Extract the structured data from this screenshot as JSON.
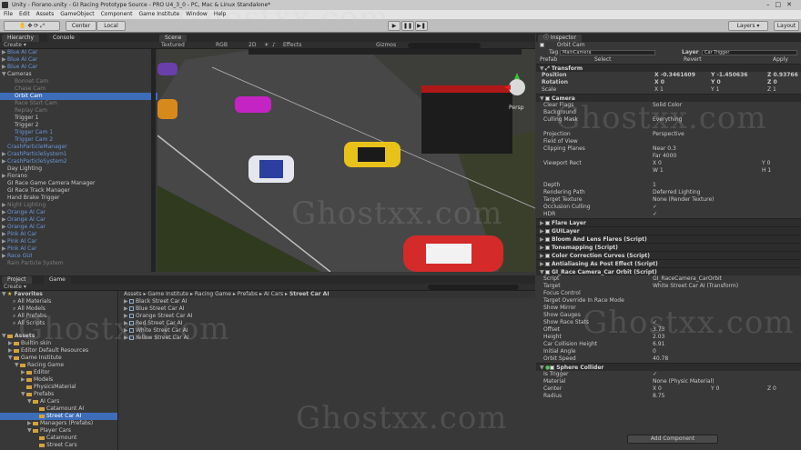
{
  "window": {
    "title": "Unity - Fiorano.unity - GI Racing Prototype Source - PRO U4_3_0 - PC, Mac & Linux Standalone*"
  },
  "menu": [
    "File",
    "Edit",
    "Assets",
    "GameObject",
    "Component",
    "Game Institute",
    "Window",
    "Help"
  ],
  "toolbar": {
    "pivot_label": "Center",
    "space_label": "Local",
    "layers_label": "Layers",
    "layout_label": "Layout"
  },
  "hierarchy": {
    "tab": "Hierarchy",
    "console_tab": "Console",
    "create_label": "Create",
    "items": [
      {
        "label": "Blue AI Car",
        "style": "blue",
        "indent": 0,
        "tri": "▶"
      },
      {
        "label": "Blue AI Car",
        "style": "blue",
        "indent": 0,
        "tri": "▶"
      },
      {
        "label": "Blue AI Car",
        "style": "blue",
        "indent": 0,
        "tri": "▶"
      },
      {
        "label": "Cameras",
        "style": "",
        "indent": 0,
        "tri": "▼"
      },
      {
        "label": "Bonnet Cam",
        "style": "dim",
        "indent": 1,
        "tri": ""
      },
      {
        "label": "Chase Cam",
        "style": "dim",
        "indent": 1,
        "tri": ""
      },
      {
        "label": "Orbit Cam",
        "style": "sel",
        "indent": 1,
        "tri": ""
      },
      {
        "label": "Race Start Cam",
        "style": "dim",
        "indent": 1,
        "tri": ""
      },
      {
        "label": "Replay Cam",
        "style": "dim",
        "indent": 1,
        "tri": ""
      },
      {
        "label": "Trigger 1",
        "style": "",
        "indent": 1,
        "tri": ""
      },
      {
        "label": "Trigger 2",
        "style": "",
        "indent": 1,
        "tri": ""
      },
      {
        "label": "Trigger Cam 1",
        "style": "blue",
        "indent": 1,
        "tri": ""
      },
      {
        "label": "Trigger Cam 2",
        "style": "blue",
        "indent": 1,
        "tri": ""
      },
      {
        "label": "CrashParticleManager",
        "style": "blue",
        "indent": 0,
        "tri": ""
      },
      {
        "label": "CrashParticleSystem1",
        "style": "blue",
        "indent": 0,
        "tri": "▶"
      },
      {
        "label": "CrashParticleSystem2",
        "style": "blue",
        "indent": 0,
        "tri": "▶"
      },
      {
        "label": "Day Lighting",
        "style": "",
        "indent": 0,
        "tri": ""
      },
      {
        "label": "Fiorano",
        "style": "",
        "indent": 0,
        "tri": "▶"
      },
      {
        "label": "GI Race Game Camera Manager",
        "style": "",
        "indent": 0,
        "tri": ""
      },
      {
        "label": "GI Race Track Manager",
        "style": "",
        "indent": 0,
        "tri": ""
      },
      {
        "label": "Hand Brake Trigger",
        "style": "",
        "indent": 0,
        "tri": ""
      },
      {
        "label": "Night Lighting",
        "style": "dim",
        "indent": 0,
        "tri": "▶"
      },
      {
        "label": "Orange AI Car",
        "style": "blue",
        "indent": 0,
        "tri": "▶"
      },
      {
        "label": "Orange AI Car",
        "style": "blue",
        "indent": 0,
        "tri": "▶"
      },
      {
        "label": "Orange AI Car",
        "style": "blue",
        "indent": 0,
        "tri": "▶"
      },
      {
        "label": "Pink AI Car",
        "style": "blue",
        "indent": 0,
        "tri": "▶"
      },
      {
        "label": "Pink AI Car",
        "style": "blue",
        "indent": 0,
        "tri": "▶"
      },
      {
        "label": "Pink AI Car",
        "style": "blue",
        "indent": 0,
        "tri": "▶"
      },
      {
        "label": "Race GUI",
        "style": "blue",
        "indent": 0,
        "tri": "▶"
      },
      {
        "label": "Rain Particle System",
        "style": "dim",
        "indent": 0,
        "tri": ""
      }
    ]
  },
  "scene": {
    "tab": "Scene",
    "game_tab": "Game",
    "shading": "Textured",
    "render": "RGB",
    "mode2d": "2D",
    "effects": "Effects",
    "gizmos": "Gizmos",
    "persp": "Persp"
  },
  "project": {
    "tab": "Project",
    "create_label": "Create",
    "favorites_label": "Favorites",
    "favorites": [
      "All Materials",
      "All Models",
      "All Prefabs",
      "All Scripts"
    ],
    "tree": [
      {
        "label": "Assets",
        "indent": 0,
        "tri": "▼",
        "bold": true
      },
      {
        "label": "Builtin skin",
        "indent": 1,
        "tri": "▶"
      },
      {
        "label": "Editor Default Resources",
        "indent": 1,
        "tri": "▶"
      },
      {
        "label": "Game Institute",
        "indent": 1,
        "tri": "▼"
      },
      {
        "label": "Racing Game",
        "indent": 2,
        "tri": "▼"
      },
      {
        "label": "Editor",
        "indent": 3,
        "tri": "▶"
      },
      {
        "label": "Models",
        "indent": 3,
        "tri": "▶"
      },
      {
        "label": "PhysicsMaterial",
        "indent": 3,
        "tri": ""
      },
      {
        "label": "Prefabs",
        "indent": 3,
        "tri": "▼"
      },
      {
        "label": "AI Cars",
        "indent": 4,
        "tri": "▼"
      },
      {
        "label": "Catamount AI",
        "indent": 5,
        "tri": ""
      },
      {
        "label": "Street Car AI",
        "indent": 5,
        "tri": "",
        "sel": true
      },
      {
        "label": "Managers (Prefabs)",
        "indent": 4,
        "tri": "▶"
      },
      {
        "label": "Player Cars",
        "indent": 4,
        "tri": "▼"
      },
      {
        "label": "Catamount",
        "indent": 5,
        "tri": ""
      },
      {
        "label": "Street Cars",
        "indent": 5,
        "tri": ""
      }
    ],
    "breadcrumb": [
      "Assets",
      "Game Institute",
      "Racing Game",
      "Prefabs",
      "AI Cars",
      "Street Car AI"
    ],
    "files": [
      "Black Street Car AI",
      "Blue Street Car AI",
      "Orange Street Car AI",
      "Red Street Car AI",
      "White Street Car AI",
      "Yellow Street Car AI"
    ]
  },
  "inspector": {
    "tab": "Inspector",
    "object_name": "Orbit Cam",
    "tag_label": "Tag",
    "tag_value": "MainCamera",
    "layer_label": "Layer",
    "layer_value": "Car Trigger",
    "prefab_label": "Prefab",
    "select_label": "Select",
    "revert_label": "Revert",
    "apply_label": "Apply",
    "transform_label": "Transform",
    "position_label": "Position",
    "position": {
      "x": "-0.3461609",
      "y": "-1.450636",
      "z": "0.93766"
    },
    "rotation_label": "Rotation",
    "rotation": {
      "x": "0",
      "y": "0",
      "z": "0"
    },
    "scale_label": "Scale",
    "scale": {
      "x": "1",
      "y": "1",
      "z": "1"
    },
    "camera_label": "Camera",
    "camera_rows": [
      {
        "label": "Clear Flags",
        "value": "Solid Color"
      },
      {
        "label": "Background",
        "value": ""
      },
      {
        "label": "Culling Mask",
        "value": "Everything"
      },
      {
        "label": "",
        "value": ""
      },
      {
        "label": "Projection",
        "value": "Perspective"
      },
      {
        "label": "Field of View",
        "value": ""
      },
      {
        "label": "Clipping Planes",
        "value": "Near  0.3"
      },
      {
        "label": "",
        "value": "Far   4000"
      },
      {
        "label": "Viewport Rect",
        "value": "X  0"
      },
      {
        "label": "",
        "value": "W  1"
      },
      {
        "label": "",
        "value": ""
      },
      {
        "label": "Depth",
        "value": "1"
      },
      {
        "label": "Rendering Path",
        "value": "Deferred Lighting"
      },
      {
        "label": "Target Texture",
        "value": "None (Render Texture)"
      },
      {
        "label": "Occlusion Culling",
        "value": "✓"
      },
      {
        "label": "HDR",
        "value": "✓"
      }
    ],
    "viewport_y": [
      "Y  0",
      "H  1"
    ],
    "components": [
      "Flare Layer",
      "GUILayer",
      "Bloom And Lens Flares (Script)",
      "Tonemapping (Script)",
      "Color Correction Curves (Script)",
      "Antialiasing As Post Effect (Script)",
      "GI_Race Camera_Car Orbit (Script)"
    ],
    "script_rows": [
      {
        "label": "Script",
        "value": "GI_RaceCamera_CarOrbit"
      },
      {
        "label": "Target",
        "value": "White Street Car AI (Transform)"
      },
      {
        "label": "Focus Control",
        "value": ""
      },
      {
        "label": "Target Override In Race Mode",
        "value": ""
      },
      {
        "label": "Show Mirror",
        "value": ""
      },
      {
        "label": "Show Gauges",
        "value": ""
      },
      {
        "label": "Show Race Stats",
        "value": "✓"
      },
      {
        "label": "Offset",
        "value": "3.73"
      },
      {
        "label": "Height",
        "value": "2.03"
      },
      {
        "label": "Car Collision Height",
        "value": "6.91"
      },
      {
        "label": "Initial Angle",
        "value": "0"
      },
      {
        "label": "Orbit Speed",
        "value": "40.78"
      }
    ],
    "sphere_label": "Sphere Collider",
    "sphere_rows": [
      {
        "label": "Is Trigger",
        "value": "✓"
      },
      {
        "label": "Material",
        "value": "None (Physic Material)"
      },
      {
        "label": "Center",
        "value": "X 0"
      },
      {
        "label": "Radius",
        "value": "8.75"
      }
    ],
    "center_y": "Y 0",
    "center_z": "Z 0",
    "add_component": "Add Component"
  },
  "watermark": "Ghostxx.com",
  "colors": {
    "selection": "#3d6db8",
    "prefab_blue": "#6b95d8",
    "panel": "#383838",
    "folder": "#d2a33c"
  }
}
